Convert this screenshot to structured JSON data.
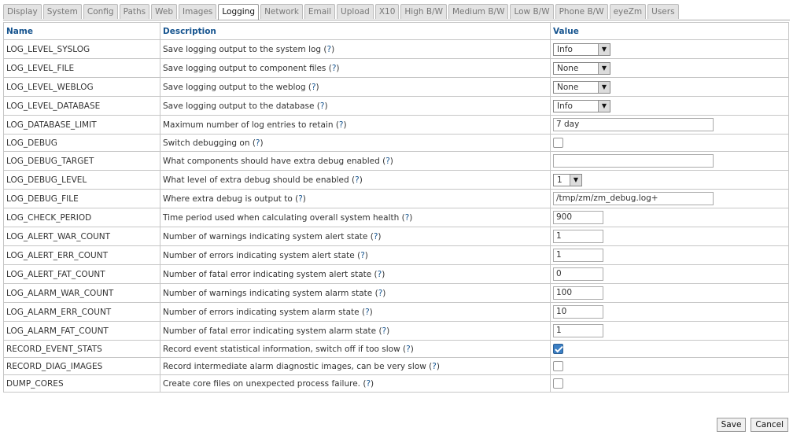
{
  "tabs": [
    "Display",
    "System",
    "Config",
    "Paths",
    "Web",
    "Images",
    "Logging",
    "Network",
    "Email",
    "Upload",
    "X10",
    "High B/W",
    "Medium B/W",
    "Low B/W",
    "Phone B/W",
    "eyeZm",
    "Users"
  ],
  "active_tab": "Logging",
  "table": {
    "headers": {
      "name": "Name",
      "description": "Description",
      "value": "Value"
    },
    "help": "?",
    "rows": [
      {
        "name": "LOG_LEVEL_SYSLOG",
        "description": "Save logging output to the system log",
        "control": "select",
        "value": "Info"
      },
      {
        "name": "LOG_LEVEL_FILE",
        "description": "Save logging output to component files",
        "control": "select",
        "value": "None"
      },
      {
        "name": "LOG_LEVEL_WEBLOG",
        "description": "Save logging output to the weblog",
        "control": "select",
        "value": "None"
      },
      {
        "name": "LOG_LEVEL_DATABASE",
        "description": "Save logging output to the database",
        "control": "select",
        "value": "Info"
      },
      {
        "name": "LOG_DATABASE_LIMIT",
        "description": "Maximum number of log entries to retain",
        "control": "text-wide",
        "value": "7 day"
      },
      {
        "name": "LOG_DEBUG",
        "description": "Switch debugging on",
        "control": "checkbox",
        "checked": false
      },
      {
        "name": "LOG_DEBUG_TARGET",
        "description": "What components should have extra debug enabled",
        "control": "text-wide",
        "value": ""
      },
      {
        "name": "LOG_DEBUG_LEVEL",
        "description": "What level of extra debug should be enabled",
        "control": "select-small",
        "value": "1"
      },
      {
        "name": "LOG_DEBUG_FILE",
        "description": "Where extra debug is output to",
        "control": "text-wide",
        "value": "/tmp/zm/zm_debug.log+"
      },
      {
        "name": "LOG_CHECK_PERIOD",
        "description": "Time period used when calculating overall system health",
        "control": "text-narrow",
        "value": "900"
      },
      {
        "name": "LOG_ALERT_WAR_COUNT",
        "description": "Number of warnings indicating system alert state",
        "control": "text-narrow",
        "value": "1"
      },
      {
        "name": "LOG_ALERT_ERR_COUNT",
        "description": "Number of errors indicating system alert state",
        "control": "text-narrow",
        "value": "1"
      },
      {
        "name": "LOG_ALERT_FAT_COUNT",
        "description": "Number of fatal error indicating system alert state",
        "control": "text-narrow",
        "value": "0"
      },
      {
        "name": "LOG_ALARM_WAR_COUNT",
        "description": "Number of warnings indicating system alarm state",
        "control": "text-narrow",
        "value": "100"
      },
      {
        "name": "LOG_ALARM_ERR_COUNT",
        "description": "Number of errors indicating system alarm state",
        "control": "text-narrow",
        "value": "10"
      },
      {
        "name": "LOG_ALARM_FAT_COUNT",
        "description": "Number of fatal error indicating system alarm state",
        "control": "text-narrow",
        "value": "1"
      },
      {
        "name": "RECORD_EVENT_STATS",
        "description": "Record event statistical information, switch off if too slow",
        "control": "checkbox",
        "checked": true
      },
      {
        "name": "RECORD_DIAG_IMAGES",
        "description": "Record intermediate alarm diagnostic images, can be very slow",
        "control": "checkbox",
        "checked": false
      },
      {
        "name": "DUMP_CORES",
        "description": "Create core files on unexpected process failure.",
        "control": "checkbox",
        "checked": false
      }
    ]
  },
  "buttons": {
    "save": "Save",
    "cancel": "Cancel"
  }
}
